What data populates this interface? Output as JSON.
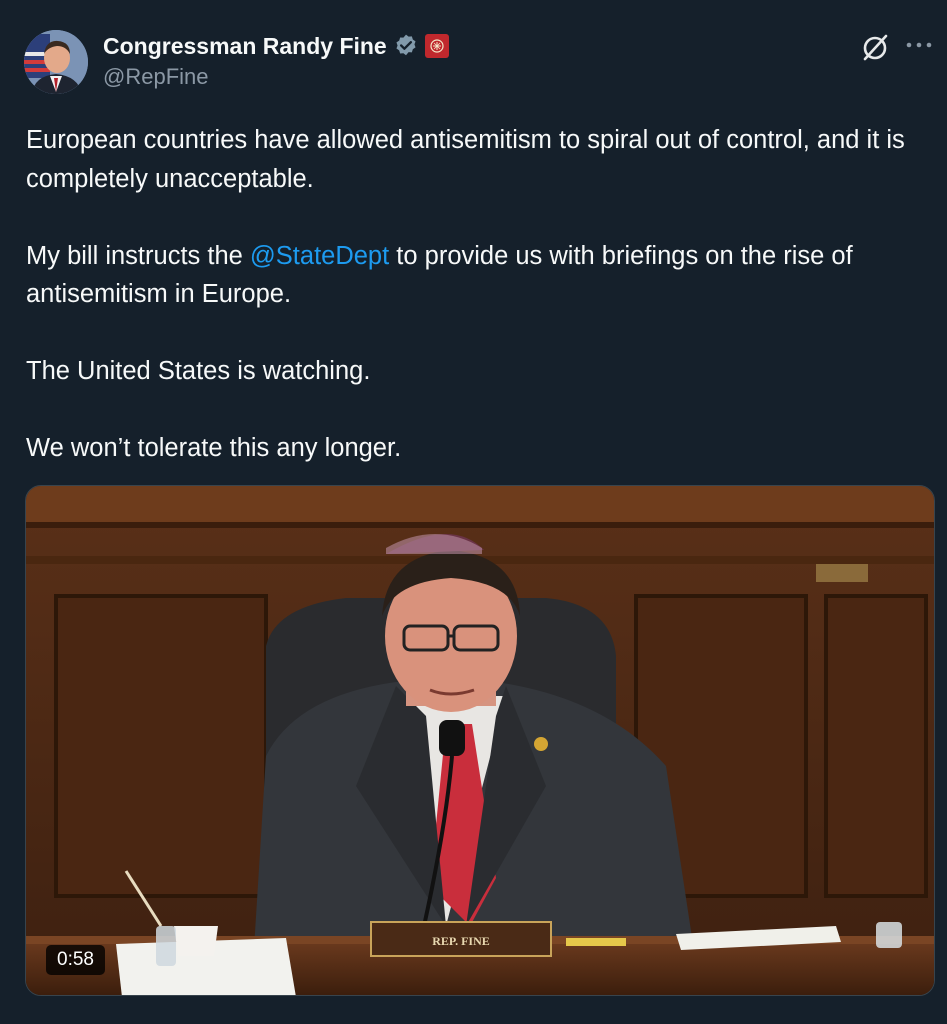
{
  "author": {
    "display_name": "Congressman Randy Fine",
    "handle": "@RepFine",
    "verified_badge": "verified-badge-icon",
    "affiliation_badge": "us-house-badge-icon"
  },
  "actions": {
    "grok_icon": "grok-icon",
    "more_icon": "more-options-icon"
  },
  "post": {
    "para1": "European countries have allowed antisemitism to spiral out of control, and it is completely unacceptable.",
    "para2_before": "My bill instructs the ",
    "para2_mention": "@StateDept",
    "para2_after": " to provide us with briefings on the rise of antisemitism in Europe.",
    "para3": "The United States is watching.",
    "para4": "We won’t tolerate this any longer."
  },
  "video": {
    "duration": "0:58",
    "nameplate": "REP. FINE"
  },
  "colors": {
    "background": "#15202b",
    "text": "#f7f9f9",
    "secondary": "#8b98a5",
    "link": "#1d9bf0"
  }
}
